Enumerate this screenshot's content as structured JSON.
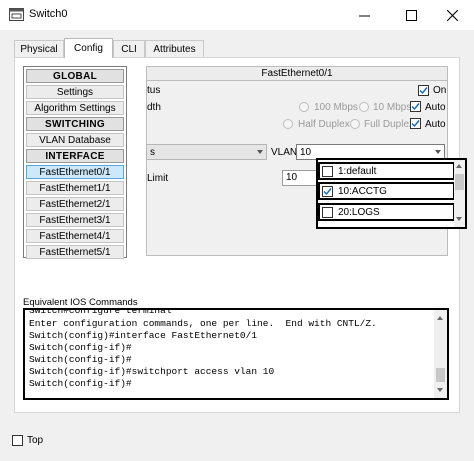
{
  "window": {
    "title": "Switch0"
  },
  "tabs": [
    {
      "label": "Physical",
      "active": false
    },
    {
      "label": "Config",
      "active": true
    },
    {
      "label": "CLI",
      "active": false
    },
    {
      "label": "Attributes",
      "active": false
    }
  ],
  "left_menu": [
    {
      "label": "GLOBAL",
      "type": "header"
    },
    {
      "label": "Settings",
      "type": "item"
    },
    {
      "label": "Algorithm Settings",
      "type": "item"
    },
    {
      "label": "SWITCHING",
      "type": "header"
    },
    {
      "label": "VLAN Database",
      "type": "item"
    },
    {
      "label": "INTERFACE",
      "type": "header"
    },
    {
      "label": "FastEthernet0/1",
      "type": "item",
      "selected": true
    },
    {
      "label": "FastEthernet1/1",
      "type": "item"
    },
    {
      "label": "FastEthernet2/1",
      "type": "item"
    },
    {
      "label": "FastEthernet3/1",
      "type": "item"
    },
    {
      "label": "FastEthernet4/1",
      "type": "item"
    },
    {
      "label": "FastEthernet5/1",
      "type": "item"
    }
  ],
  "interface_config": {
    "title": "FastEthernet0/1",
    "port_status_label": "tus",
    "port_status_on_label": "On",
    "port_status_on": true,
    "bandwidth_label": "dth",
    "speed_100": "100 Mbps",
    "speed_10": "10 Mbps",
    "auto_label": "Auto",
    "bandwidth_auto": true,
    "half_duplex": "Half Duplex",
    "full_duplex": "Full Duplex",
    "duplex_auto": true,
    "mode_value": "s",
    "vlan_label": "VLAN",
    "vlan_value": "10",
    "limit_label": "Limit",
    "limit_value": "10"
  },
  "vlan_dropdown": {
    "options": [
      {
        "label": "1:default",
        "checked": false
      },
      {
        "label": "10:ACCTG",
        "checked": true
      },
      {
        "label": "20:LOGS",
        "checked": false
      }
    ]
  },
  "ios": {
    "label": "Equivalent IOS Commands",
    "lines": [
      "Switch#configure terminal",
      "Enter configuration commands, one per line.  End with CNTL/Z.",
      "Switch(config)#interface FastEthernet0/1",
      "Switch(config-if)#",
      "Switch(config-if)#",
      "Switch(config-if)#switchport access vlan 10",
      "Switch(config-if)#"
    ]
  },
  "footer": {
    "top_label": "Top",
    "top_checked": false
  },
  "colors": {
    "selected_bg": "#cde8fb",
    "selected_border": "#58a6de",
    "check_blue": "#1565c0"
  }
}
